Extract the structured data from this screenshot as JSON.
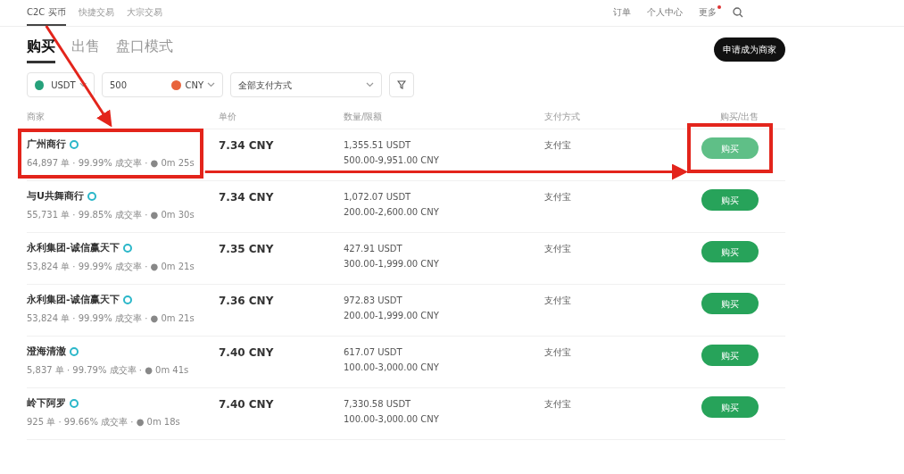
{
  "top_nav": {
    "items": [
      {
        "label": "C2C 买币",
        "selected": true
      },
      {
        "label": "快捷交易",
        "selected": false
      },
      {
        "label": "大宗交易",
        "selected": false
      }
    ],
    "right_items": [
      {
        "kind": "link",
        "label": "订单",
        "dot": false
      },
      {
        "kind": "link",
        "label": "个人中心",
        "dot": false
      },
      {
        "kind": "menu",
        "label": "更多",
        "dot": true
      },
      {
        "kind": "search"
      }
    ]
  },
  "mode_tabs": [
    {
      "label": "购买",
      "selected": true
    },
    {
      "label": "出售",
      "selected": false
    },
    {
      "label": "盘口模式",
      "selected": false
    }
  ],
  "apply_button": "申请成为商家",
  "filters": {
    "crypto": {
      "value": "USDT",
      "color": "#26a17b"
    },
    "amount": {
      "value": "500"
    },
    "fiat": {
      "value": "CNY",
      "color": "#e8643c"
    },
    "payment": {
      "value": "全部支付方式"
    }
  },
  "table": {
    "columns": [
      "商家",
      "单价",
      "数量/限额",
      "支付方式",
      "购买/出售"
    ],
    "rows": [
      {
        "merchant": "广州商行",
        "stats": "64,897 单 · 99.99% 成交率 · ● 0m 25s",
        "price": "7.34 CNY",
        "quantity": "1,355.51 USDT",
        "limit": "500.00-9,951.00 CNY",
        "payment": "支付宝",
        "action": "购买",
        "annotated": true,
        "hovered": true
      },
      {
        "merchant": "与U共舞商行",
        "stats": "55,731 单 · 99.85% 成交率 · ● 0m 30s",
        "price": "7.34 CNY",
        "quantity": "1,072.07 USDT",
        "limit": "200.00-2,600.00 CNY",
        "payment": "支付宝",
        "action": "购买",
        "annotated": false,
        "hovered": false
      },
      {
        "merchant": "永利集团-诚信赢天下",
        "stats": "53,824 单 · 99.99% 成交率 · ● 0m 21s",
        "price": "7.35 CNY",
        "quantity": "427.91 USDT",
        "limit": "300.00-1,999.00 CNY",
        "payment": "支付宝",
        "action": "购买",
        "annotated": false,
        "hovered": false
      },
      {
        "merchant": "永利集团-诚信赢天下",
        "stats": "53,824 单 · 99.99% 成交率 · ● 0m 21s",
        "price": "7.36 CNY",
        "quantity": "972.83 USDT",
        "limit": "200.00-1,999.00 CNY",
        "payment": "支付宝",
        "action": "购买",
        "annotated": false,
        "hovered": false
      },
      {
        "merchant": "澄海清澈",
        "stats": "5,837 单 · 99.79% 成交率 · ● 0m 41s",
        "price": "7.40 CNY",
        "quantity": "617.07 USDT",
        "limit": "100.00-3,000.00 CNY",
        "payment": "支付宝",
        "action": "购买",
        "annotated": false,
        "hovered": false
      },
      {
        "merchant": "岭下阿罗",
        "stats": "925 单 · 99.66% 成交率 · ● 0m 18s",
        "price": "7.40 CNY",
        "quantity": "7,330.58 USDT",
        "limit": "100.00-3,000.00 CNY",
        "payment": "支付宝",
        "action": "购买",
        "annotated": false,
        "hovered": false
      }
    ]
  }
}
